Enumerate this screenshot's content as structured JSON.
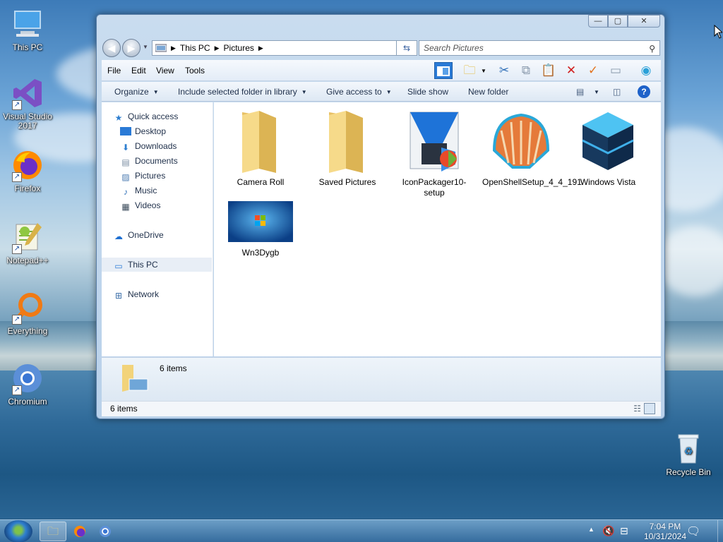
{
  "desktop": {
    "icons": [
      {
        "label": "This PC",
        "icon": "monitor-icon"
      },
      {
        "label": "Visual Studio 2017",
        "icon": "visual-studio-icon"
      },
      {
        "label": "Firefox",
        "icon": "firefox-icon"
      },
      {
        "label": "Notepad++",
        "icon": "notepad-plus-plus-icon"
      },
      {
        "label": "Everything",
        "icon": "everything-search-icon"
      },
      {
        "label": "Chromium",
        "icon": "chromium-icon"
      }
    ],
    "recycle_bin": "Recycle Bin"
  },
  "window": {
    "address": {
      "segments": [
        "This PC",
        "Pictures"
      ]
    },
    "search": {
      "placeholder": "Search Pictures"
    },
    "menu": [
      "File",
      "Edit",
      "View",
      "Tools"
    ],
    "commands": {
      "organize": "Organize",
      "include": "Include selected folder in library",
      "give_access": "Give access to",
      "slide_show": "Slide show",
      "new_folder": "New folder"
    },
    "nav": {
      "quick_access": "Quick access",
      "quick_items": [
        "Desktop",
        "Downloads",
        "Documents",
        "Pictures",
        "Music",
        "Videos"
      ],
      "onedrive": "OneDrive",
      "this_pc": "This PC",
      "network": "Network"
    },
    "files": [
      {
        "name": "Camera Roll",
        "icon": "folder-icon"
      },
      {
        "name": "Saved Pictures",
        "icon": "folder-icon"
      },
      {
        "name": "IconPackager10-setup",
        "icon": "installer-icon"
      },
      {
        "name": "OpenShellSetup_4_4_191",
        "icon": "shell-icon"
      },
      {
        "name": "Windows Vista",
        "icon": "cube-icon"
      },
      {
        "name": "Wn3Dygb",
        "icon": "wallpaper-thumbnail-icon"
      }
    ],
    "details_count": "6 items",
    "status_count": "6 items"
  },
  "taskbar": {
    "time": "7:04 PM",
    "date": "10/31/2024"
  },
  "colors": {
    "accent": "#1e62c9",
    "folder": "#f2d37a",
    "delete_red": "#d11f1f",
    "check_orange": "#e2731f"
  }
}
